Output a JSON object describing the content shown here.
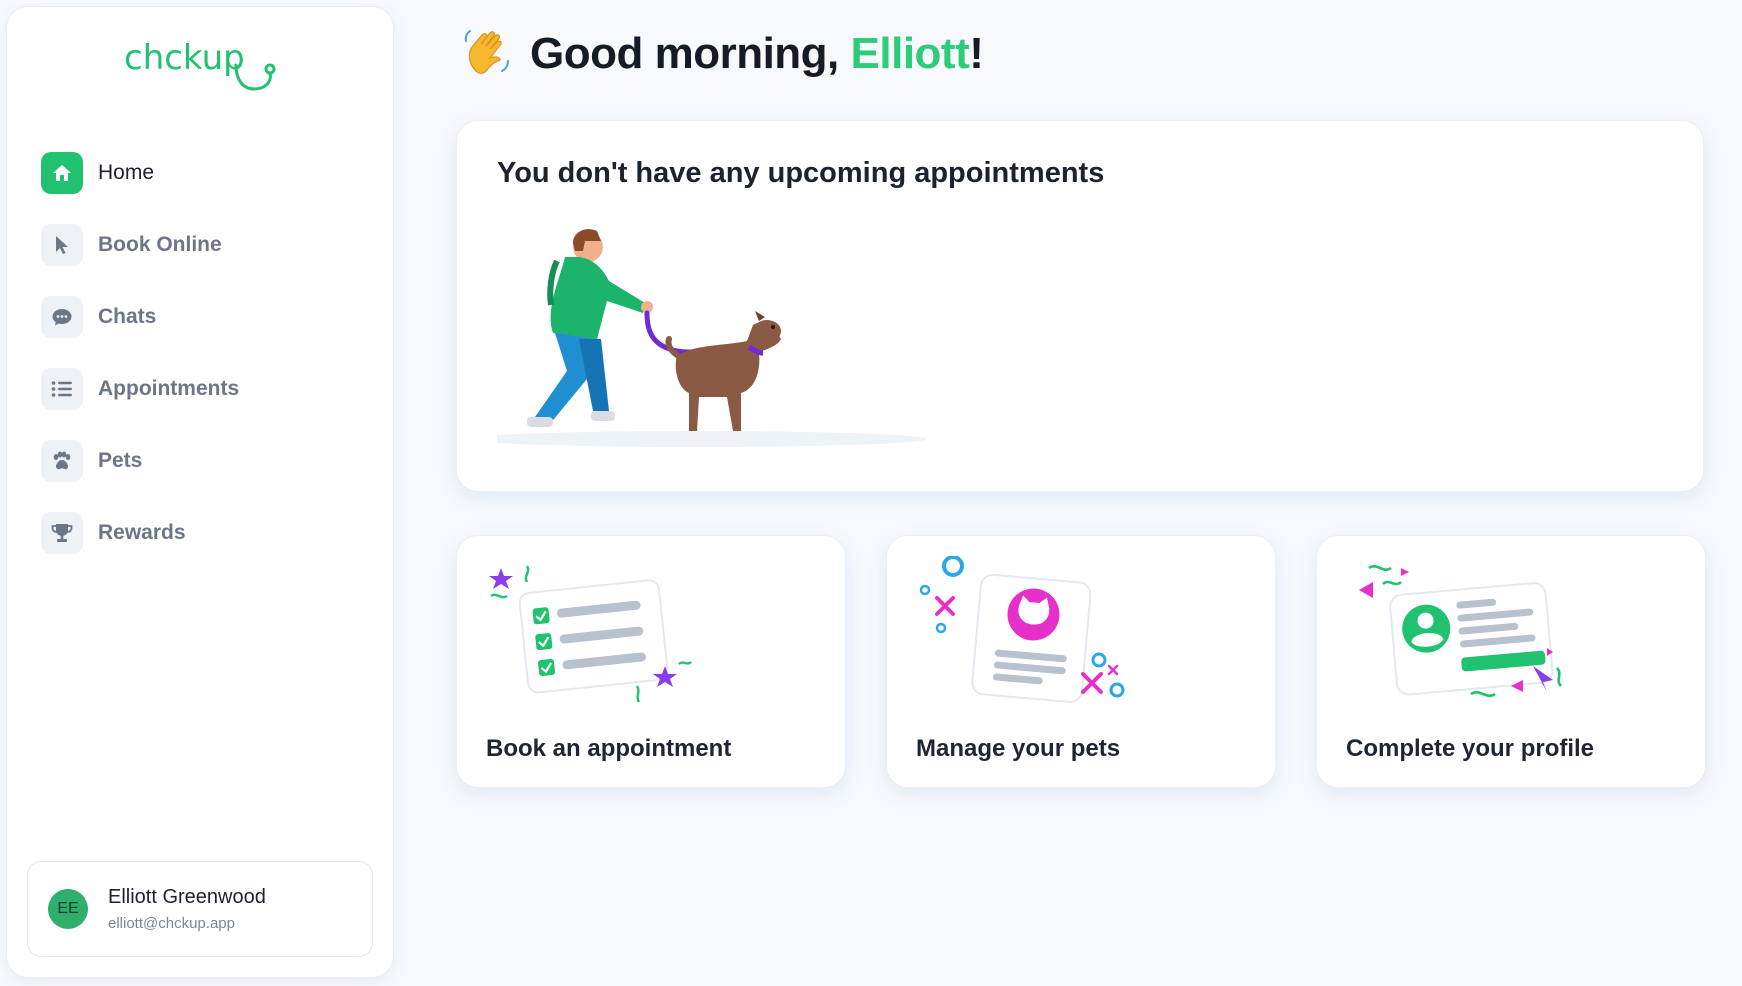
{
  "app": {
    "logo_text": "chckup",
    "brand_color": "#21c26f"
  },
  "sidebar": {
    "items": [
      {
        "label": "Home",
        "icon": "home-icon",
        "active": true
      },
      {
        "label": "Book Online",
        "icon": "cursor-icon",
        "active": false
      },
      {
        "label": "Chats",
        "icon": "chat-bubble-icon",
        "active": false
      },
      {
        "label": "Appointments",
        "icon": "list-icon",
        "active": false
      },
      {
        "label": "Pets",
        "icon": "paw-icon",
        "active": false
      },
      {
        "label": "Rewards",
        "icon": "trophy-icon",
        "active": false
      }
    ],
    "user": {
      "initials": "EE",
      "name": "Elliott Greenwood",
      "email": "elliott@chckup.app"
    }
  },
  "header": {
    "greeting_emoji": "waving-hand-icon",
    "greeting_prefix": "Good morning, ",
    "greeting_name": "Elliott",
    "greeting_suffix": "!"
  },
  "appointments": {
    "empty_message": "You don't have any upcoming appointments"
  },
  "actions": [
    {
      "label": "Book an appointment",
      "icon": "checklist-illustration"
    },
    {
      "label": "Manage your pets",
      "icon": "pet-profile-illustration"
    },
    {
      "label": "Complete your profile",
      "icon": "profile-card-illustration"
    }
  ]
}
